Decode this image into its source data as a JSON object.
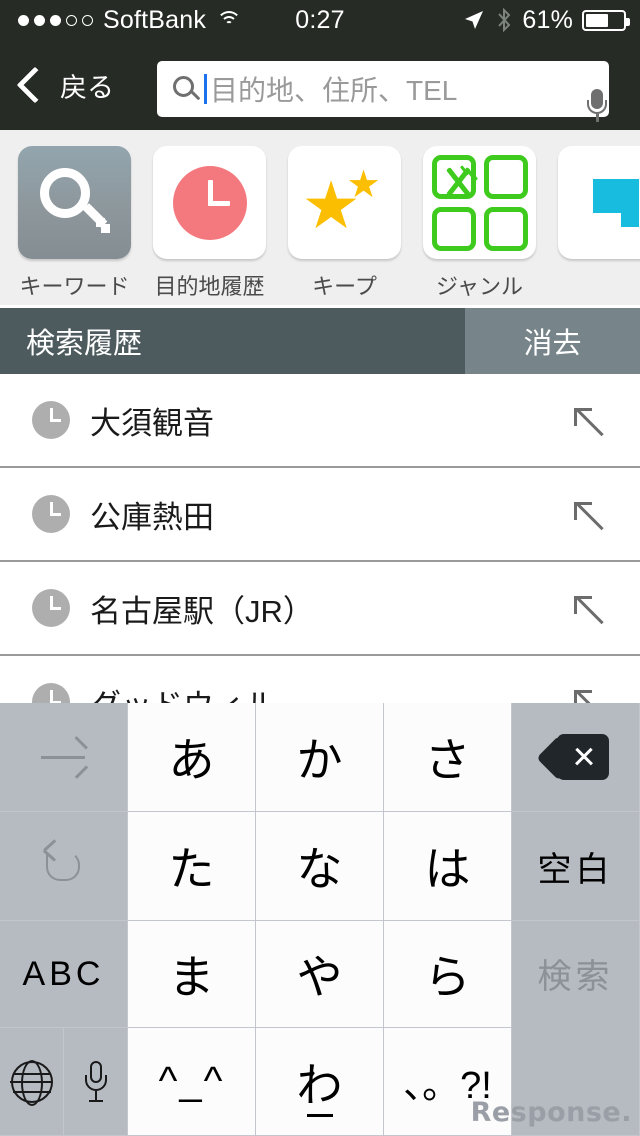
{
  "statusbar": {
    "signal_filled": 3,
    "signal_empty": 2,
    "carrier": "SoftBank",
    "wifi_icon": "wifi-icon",
    "time": "0:27",
    "location_icon": "location-arrow-icon",
    "bluetooth_icon": "bluetooth-icon",
    "battery_percent": "61%",
    "battery_level": 61
  },
  "navbar": {
    "back_label": "戻る",
    "back_icon": "chevron-left-icon",
    "search_icon": "search-icon",
    "mic_icon": "microphone-icon",
    "search_value": "",
    "search_placeholder": "目的地、住所、TEL"
  },
  "tiles": [
    {
      "label": "キーワード",
      "icon": "search-magnifier-icon",
      "selected": true
    },
    {
      "label": "目的地履歴",
      "icon": "clock-icon",
      "selected": false
    },
    {
      "label": "キープ",
      "icon": "stars-icon",
      "selected": false
    },
    {
      "label": "ジャンル",
      "icon": "genre-grid-fork-knife-icon",
      "selected": false
    },
    {
      "label": "",
      "icon": "map-pin-icon",
      "selected": false
    }
  ],
  "section": {
    "title": "検索履歴",
    "clear_label": "消去"
  },
  "history": [
    {
      "label": "大須観音",
      "icon": "clock-icon",
      "action_icon": "arrow-up-left-icon"
    },
    {
      "label": "公庫熱田",
      "icon": "clock-icon",
      "action_icon": "arrow-up-left-icon"
    },
    {
      "label": "名古屋駅（JR）",
      "icon": "clock-icon",
      "action_icon": "arrow-up-left-icon"
    },
    {
      "label": "グッドウィル",
      "icon": "clock-icon",
      "action_icon": "arrow-up-left-icon"
    }
  ],
  "keyboard": {
    "next_icon": "arrow-right-icon",
    "undo_icon": "undo-icon",
    "delete_icon": "backspace-delete-icon",
    "globe_icon": "globe-language-icon",
    "mic_icon": "microphone-icon",
    "keys": {
      "a": "あ",
      "ka": "か",
      "sa": "さ",
      "ta": "た",
      "na": "な",
      "ha": "は",
      "ma": "ま",
      "ya": "や",
      "ra": "ら",
      "kaomoji": "^_^",
      "wa": "わ",
      "punct": "、。?!",
      "abc": "ABC",
      "space": "空白",
      "search": "検索"
    }
  },
  "watermark": "Response."
}
